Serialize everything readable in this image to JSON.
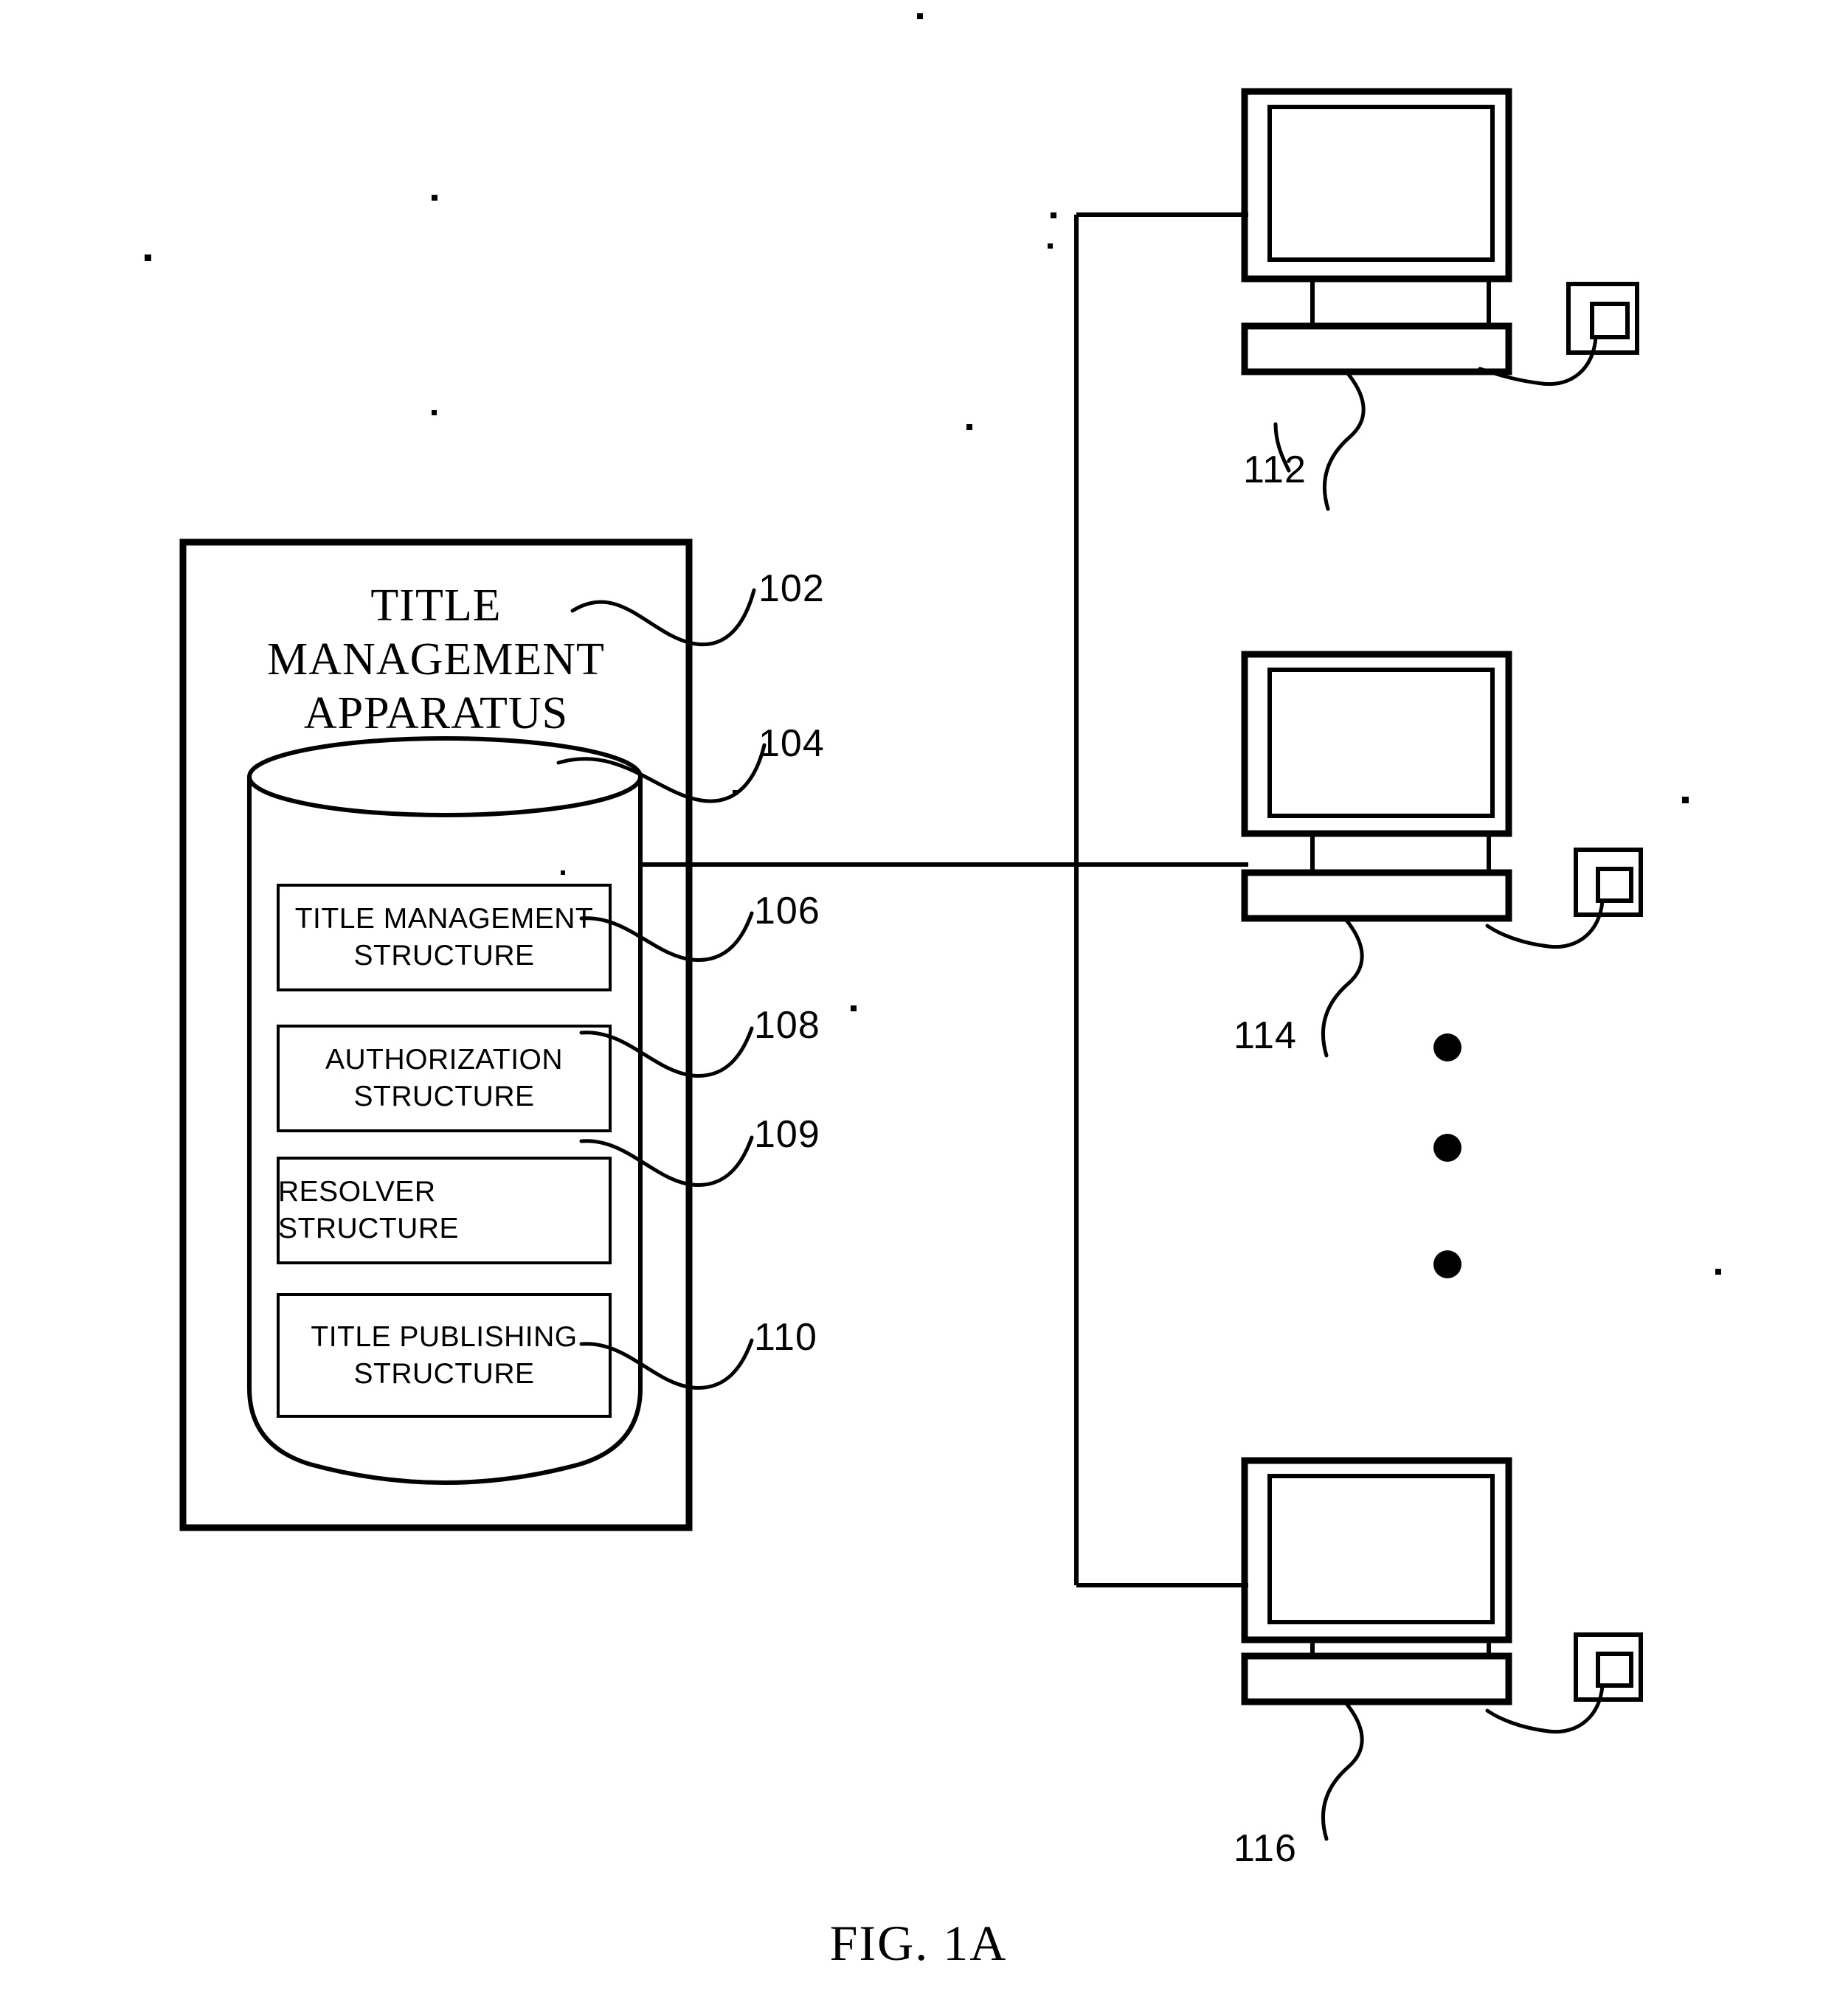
{
  "figure": {
    "caption": "FIG. 1A",
    "apparatus": {
      "title_line1": "TITLE",
      "title_line2": "MANAGEMENT",
      "title_line3": "APPARATUS",
      "ref_apparatus": "102",
      "ref_database": "104"
    },
    "structures": [
      {
        "line1": "TITLE MANAGEMENT",
        "line2": "STRUCTURE",
        "ref": "106"
      },
      {
        "line1": "AUTHORIZATION",
        "line2": "STRUCTURE",
        "ref": "108"
      },
      {
        "line1": "RESOLVER STRUCTURE",
        "line2": "",
        "ref": "109"
      },
      {
        "line1": "TITLE PUBLISHING",
        "line2": "STRUCTURE",
        "ref": "110"
      }
    ],
    "terminals": [
      {
        "ref": "112",
        "name": "terminal-top"
      },
      {
        "ref": "114",
        "name": "terminal-middle"
      },
      {
        "ref": "116",
        "name": "terminal-bottom"
      }
    ],
    "ellipsis": "• • •",
    "colors": {
      "ink": "#000000",
      "paper": "#ffffff"
    }
  }
}
